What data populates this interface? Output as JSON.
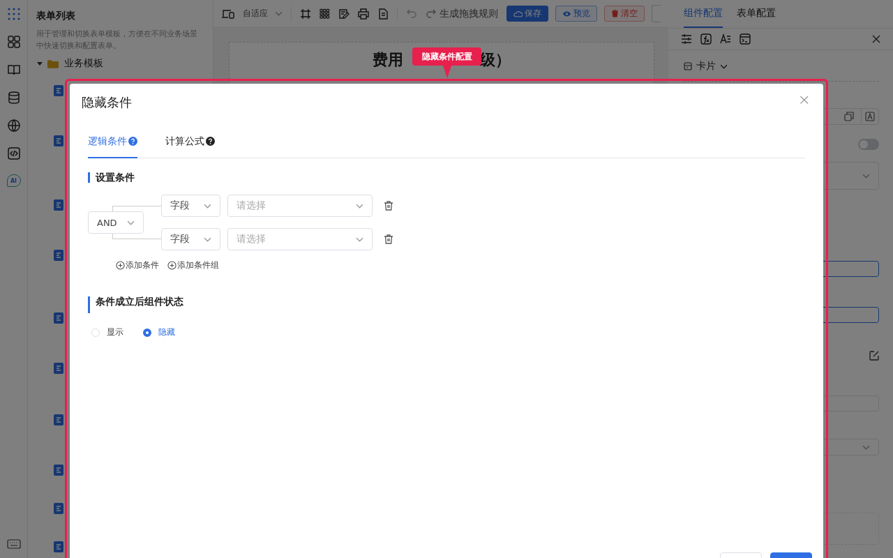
{
  "rail": {
    "ai_label": "AI"
  },
  "sidebar": {
    "title": "表单列表",
    "description": "用于管理和切换表单模板，方便在不同业务场景中快速切换和配置表单。",
    "tree": [
      {
        "label": "业务模板",
        "expanded": true
      }
    ]
  },
  "toolbar": {
    "device": "自适应",
    "generate": "生成拖拽规则",
    "buttons": [
      {
        "label": "保存",
        "kind": "primary"
      },
      {
        "label": "预览",
        "kind": "outline"
      },
      {
        "label": "清空",
        "kind": "danger"
      }
    ]
  },
  "canvas": {
    "title_parts": [
      "费用",
      "级）"
    ]
  },
  "right_panel": {
    "tabs": [
      {
        "label": "组件配置",
        "selected": true
      },
      {
        "label": "表单配置",
        "selected": false
      }
    ],
    "component_type": "卡片",
    "toggle": {
      "on": false
    }
  },
  "highlight": {
    "label": "隐藏条件配置"
  },
  "dialog": {
    "title": "隐藏条件",
    "close": "×",
    "tabs": [
      {
        "label": "逻辑条件",
        "selected": true
      },
      {
        "label": "计算公式",
        "selected": false
      }
    ],
    "condition": {
      "heading": "设置条件",
      "operator": "AND",
      "rows": [
        {
          "field": "字段",
          "placeholder": "请选择"
        },
        {
          "field": "字段",
          "placeholder": "请选择"
        }
      ],
      "actions": [
        "添加条件",
        "添加条件组"
      ]
    },
    "state": {
      "heading": "条件成立后组件状态",
      "options": [
        {
          "label": "显示",
          "selected": false
        },
        {
          "label": "隐藏",
          "selected": true
        }
      ]
    }
  }
}
